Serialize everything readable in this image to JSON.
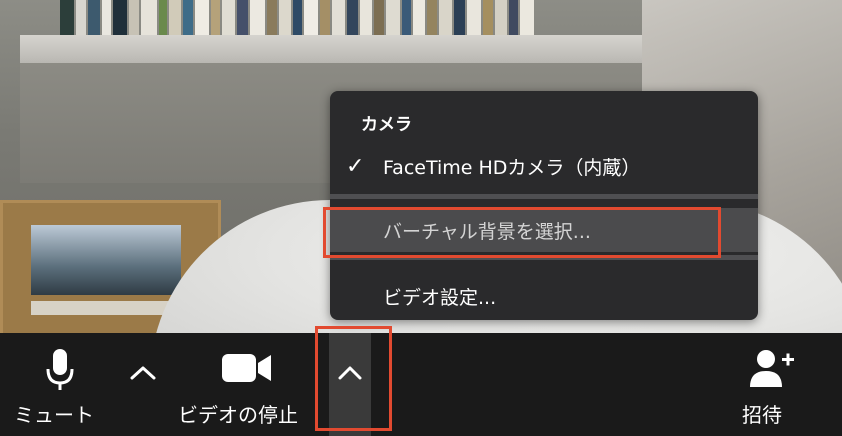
{
  "menu": {
    "heading": "カメラ",
    "camera_item": "FaceTime HDカメラ（内蔵）",
    "virtual_bg_item": "バーチャル背景を選択...",
    "video_settings_item": "ビデオ設定..."
  },
  "toolbar": {
    "mute_label": "ミュート",
    "stop_video_label": "ビデオの停止",
    "invite_label": "招待"
  },
  "icons": {
    "check": "checkmark-icon",
    "mute": "microphone-icon",
    "video": "video-camera-icon",
    "invite": "add-person-icon",
    "caret": "chevron-up-icon"
  },
  "colors": {
    "menu_bg": "#2a2a2c",
    "menu_highlight": "#4b4b4d",
    "toolbar_bg": "#1a1a1a",
    "annotation": "#e24a30"
  }
}
